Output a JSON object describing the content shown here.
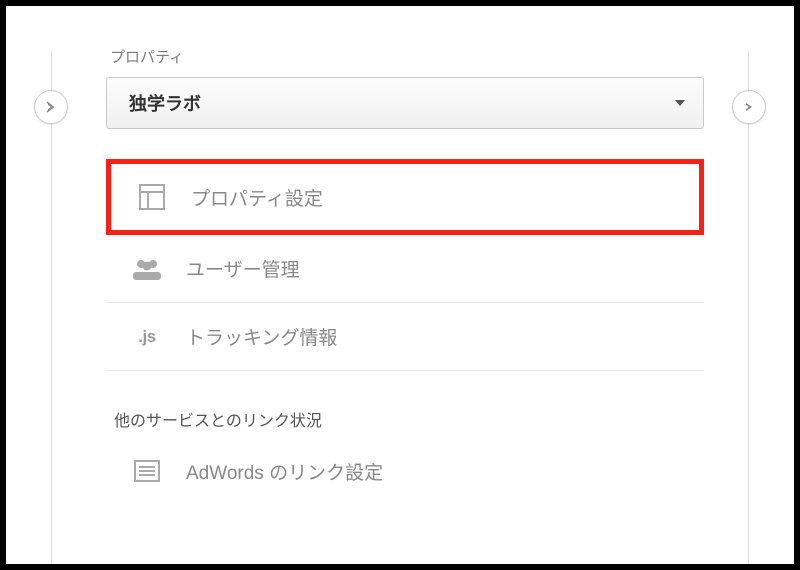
{
  "section_label": "プロパティ",
  "dropdown": {
    "selected": "独学ラボ"
  },
  "menu": {
    "property_settings": "プロパティ設定",
    "user_management": "ユーザー管理",
    "tracking_info": "トラッキング情報"
  },
  "sub_section_label": "他のサービスとのリンク状況",
  "links": {
    "adwords": "AdWords のリンク設定"
  },
  "icons": {
    "js": ".js"
  }
}
